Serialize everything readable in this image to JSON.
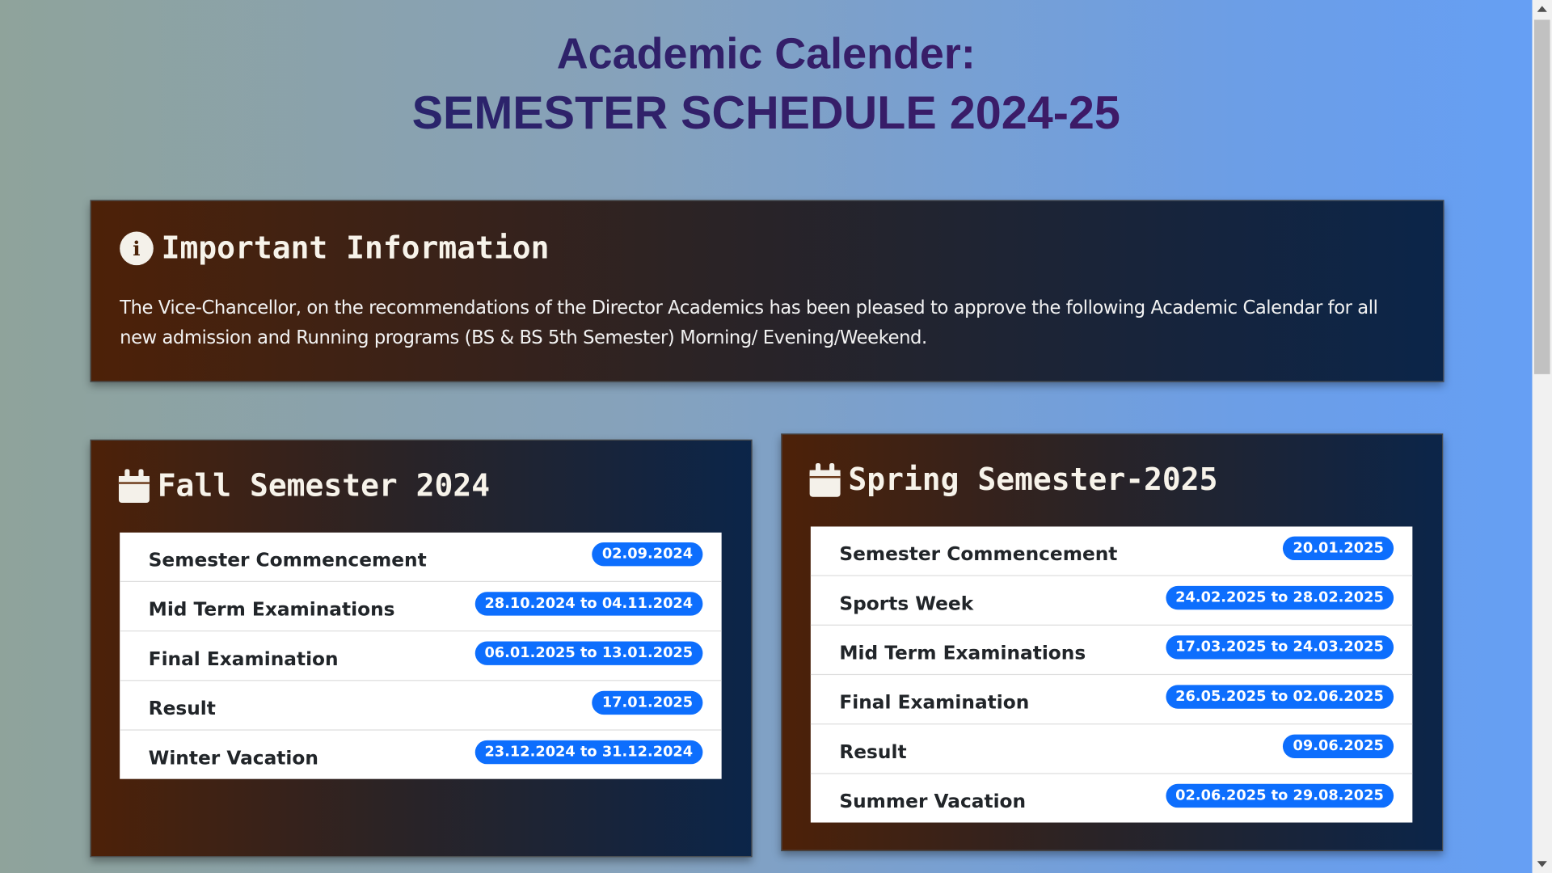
{
  "header": {
    "title_line1": "Academic Calender:",
    "title_line2": "SEMESTER SCHEDULE 2024-25"
  },
  "info": {
    "icon": "info-circle-icon",
    "heading": "Important Information",
    "text": "The Vice-Chancellor, on the recommendations of the Director Academics has been pleased to approve the following Academic Calendar for all new admission and Running programs (BS & BS 5th Semester) Morning/ Evening/Weekend."
  },
  "fall": {
    "icon": "calendar-icon",
    "heading": "Fall Semester 2024",
    "items": [
      {
        "label": "Semester Commencement",
        "date": "02.09.2024"
      },
      {
        "label": "Mid Term Examinations",
        "date": "28.10.2024 to 04.11.2024"
      },
      {
        "label": "Final Examination",
        "date": "06.01.2025 to 13.01.2025"
      },
      {
        "label": "Result",
        "date": "17.01.2025"
      },
      {
        "label": "Winter Vacation",
        "date": "23.12.2024 to 31.12.2024"
      }
    ]
  },
  "spring": {
    "icon": "calendar-icon",
    "heading": "Spring Semester-2025",
    "items": [
      {
        "label": "Semester Commencement",
        "date": "20.01.2025"
      },
      {
        "label": "Sports Week",
        "date": "24.02.2025 to 28.02.2025"
      },
      {
        "label": "Mid Term Examinations",
        "date": "17.03.2025 to 24.03.2025"
      },
      {
        "label": "Final Examination",
        "date": "26.05.2025 to 02.06.2025"
      },
      {
        "label": "Result",
        "date": "09.06.2025"
      },
      {
        "label": "Summer Vacation",
        "date": "02.06.2025 to 29.08.2025"
      }
    ]
  },
  "colors": {
    "badge": "#0d6efd",
    "panel_start": "#4d2108",
    "panel_end": "#0b2549",
    "title": "#1d2a6e"
  }
}
